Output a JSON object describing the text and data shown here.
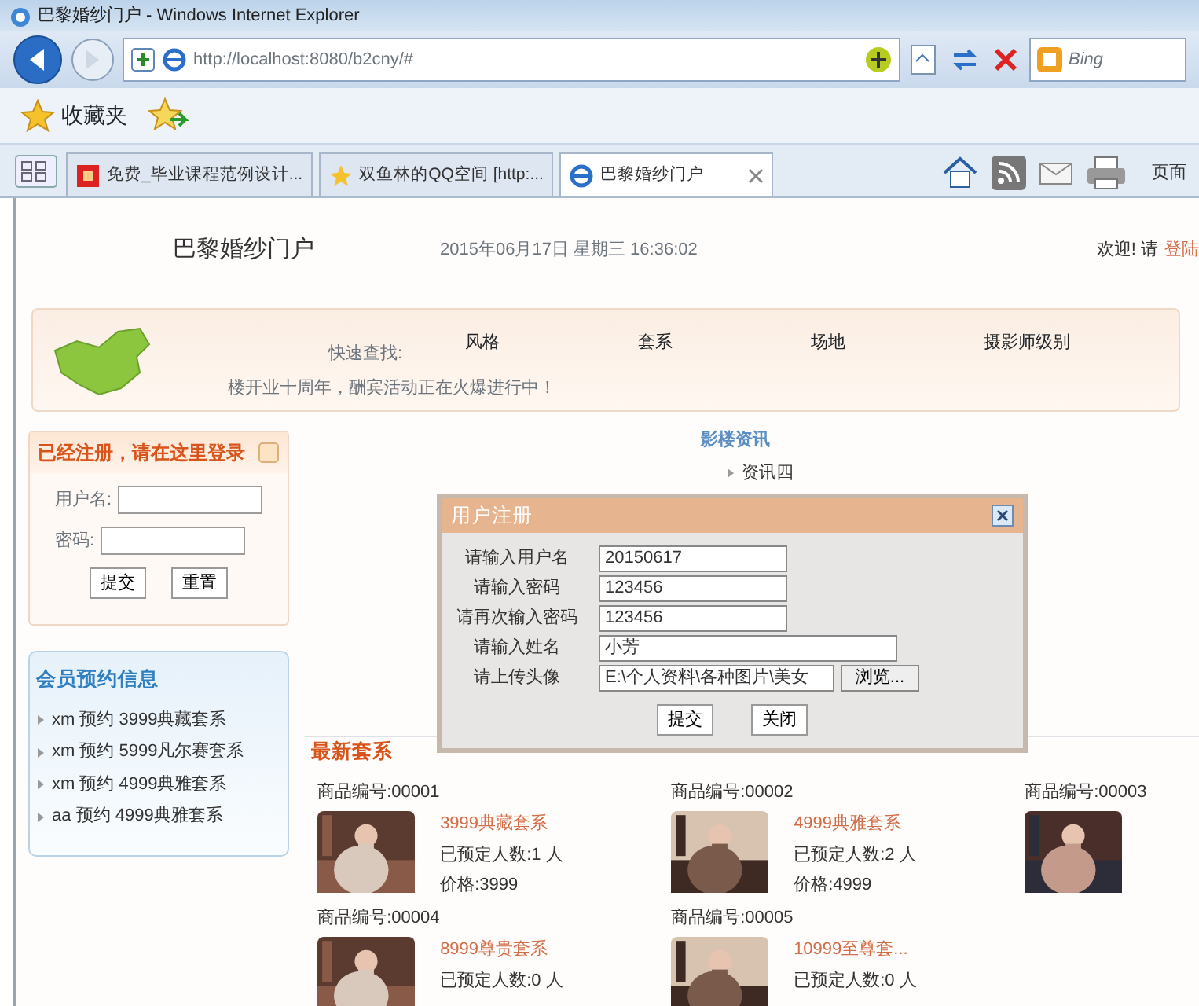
{
  "window": {
    "title": "巴黎婚纱门户 - Windows Internet Explorer"
  },
  "address_bar": {
    "url": "http://localhost:8080/b2cny/#",
    "search_placeholder": "Bing"
  },
  "favorites_bar": {
    "label": "收藏夹"
  },
  "tabs": [
    {
      "label": "免费_毕业课程范例设计...",
      "selected": false,
      "kind": "red"
    },
    {
      "label": "双鱼林的QQ空间 [http:...",
      "selected": false,
      "kind": "star"
    },
    {
      "label": "巴黎婚纱门户",
      "selected": true,
      "kind": "ie"
    }
  ],
  "command_bar": {
    "page_label": "页面"
  },
  "header": {
    "site_title": "巴黎婚纱门户",
    "datetime": "2015年06月17日 星期三 16:36:02",
    "welcome": "欢迎! 请",
    "login_link": "登陆"
  },
  "quick_search": {
    "label": "快速查找:",
    "categories": [
      "风格",
      "套系",
      "场地",
      "摄影师级别"
    ],
    "marquee": "楼开业十周年，酬宾活动正在火爆进行中！"
  },
  "login_panel": {
    "title": "已经注册，请在这里登录",
    "fields": [
      {
        "label": "用户名:"
      },
      {
        "label": "密码:"
      }
    ],
    "buttons": [
      "提交",
      "重置"
    ]
  },
  "reservations": {
    "title": "会员预约信息",
    "items": [
      "xm 预约 3999典藏套系",
      "xm 预约 5999凡尔赛套系",
      "xm 预约 4999典雅套系",
      "aa 预约 4999典雅套系"
    ]
  },
  "news": {
    "title": "影楼资讯",
    "items": [
      "资讯四"
    ]
  },
  "register_dialog": {
    "title": "用户注册",
    "fields": [
      {
        "label": "请输入用户名",
        "value": "20150617",
        "kind": "text"
      },
      {
        "label": "请输入密码",
        "value": "123456",
        "kind": "text"
      },
      {
        "label": "请再次输入密码",
        "value": "123456",
        "kind": "text"
      },
      {
        "label": "请输入姓名",
        "value": "小芳",
        "kind": "wide"
      },
      {
        "label": "请上传头像",
        "value": "E:\\个人资料\\各种图片\\美女",
        "kind": "file",
        "button": "浏览..."
      }
    ],
    "buttons": [
      "提交",
      "关闭"
    ]
  },
  "latest_packages": {
    "title": "最新套系",
    "products": [
      {
        "code": "商品编号:00001",
        "name": "3999典藏套系",
        "booked": "已预定人数:1 人",
        "price": "价格:3999"
      },
      {
        "code": "商品编号:00002",
        "name": "4999典雅套系",
        "booked": "已预定人数:2 人",
        "price": "价格:4999"
      },
      {
        "code": "商品编号:00003"
      },
      {
        "code": "商品编号:00004",
        "name": "8999尊贵套系",
        "booked": "已预定人数:0 人"
      },
      {
        "code": "商品编号:00005",
        "name": "10999至尊套...",
        "booked": "已预定人数:0 人"
      }
    ]
  }
}
